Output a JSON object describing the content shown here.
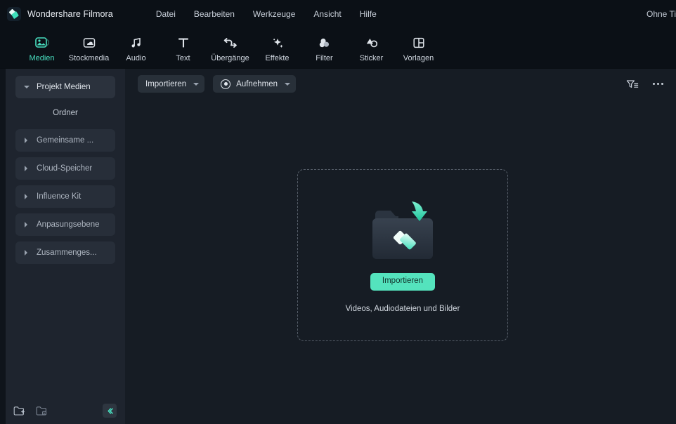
{
  "titlebar": {
    "brand": "Wondershare Filmora",
    "logo_icon": "filmora-diamond-logo",
    "document_title": "Ohne Ti",
    "menu": [
      {
        "label": "Datei"
      },
      {
        "label": "Bearbeiten"
      },
      {
        "label": "Werkzeuge"
      },
      {
        "label": "Ansicht"
      },
      {
        "label": "Hilfe"
      }
    ]
  },
  "ribbon": {
    "active_color": "#49dfc0",
    "items": [
      {
        "label": "Medien",
        "icon": "media-image-icon",
        "active": true
      },
      {
        "label": "Stockmedia",
        "icon": "cloud-folder-icon",
        "active": false
      },
      {
        "label": "Audio",
        "icon": "music-note-icon",
        "active": false
      },
      {
        "label": "Text",
        "icon": "text-t-icon",
        "active": false
      },
      {
        "label": "Übergänge",
        "icon": "transition-arrows-icon",
        "active": false
      },
      {
        "label": "Effekte",
        "icon": "magic-wand-icon",
        "active": false
      },
      {
        "label": "Filter",
        "icon": "color-circles-icon",
        "active": false
      },
      {
        "label": "Sticker",
        "icon": "sticker-shapes-icon",
        "active": false
      },
      {
        "label": "Vorlagen",
        "icon": "template-grid-icon",
        "active": false
      }
    ]
  },
  "sidebar": {
    "items": [
      {
        "label": "Projekt Medien",
        "caret": "down",
        "selected": true
      },
      {
        "label": "Gemeinsame ...",
        "caret": "right",
        "selected": false
      },
      {
        "label": "Cloud-Speicher",
        "caret": "right",
        "selected": false
      },
      {
        "label": "Influence Kit",
        "caret": "right",
        "selected": false
      },
      {
        "label": "Anpasungsebene",
        "caret": "right",
        "selected": false
      },
      {
        "label": "Zusammenges...",
        "caret": "right",
        "selected": false
      }
    ],
    "subheading": "Ordner",
    "footer": {
      "new_folder_icon": "new-folder-icon",
      "folder_options_icon": "folder-settings-icon",
      "collapse_icon": "collapse-left-chevron-icon"
    }
  },
  "main": {
    "toolbar": {
      "import_label": "Importieren",
      "import_caret_icon": "chevron-down-icon",
      "record_label": "Aufnehmen",
      "record_icon": "record-dot-icon",
      "record_caret_icon": "chevron-down-icon",
      "filter_icon": "filter-sort-icon",
      "more_icon": "more-options-icon"
    },
    "dropzone": {
      "folder_icon": "folder-download-icon",
      "import_button": "Importieren",
      "caption": "Videos, Audiodateien und Bilder"
    }
  }
}
